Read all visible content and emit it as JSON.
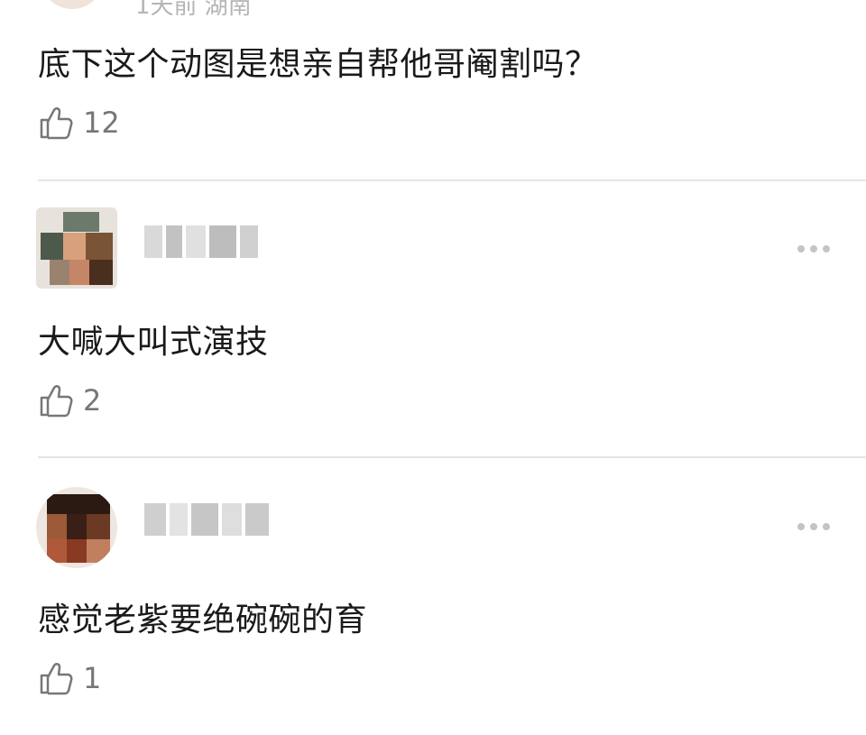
{
  "comments": [
    {
      "meta": "1天前 湖南",
      "text": "底下这个动图是想亲自帮他哥阉割吗？",
      "likes": "12"
    },
    {
      "text": "大喊大叫式演技",
      "likes": "2"
    },
    {
      "text": "感觉老紫要绝碗碗的育",
      "likes": "1"
    }
  ],
  "icons": {
    "like": "thumbs-up-icon",
    "more": "more-icon"
  },
  "colors": {
    "text": "#1a1a1a",
    "meta": "#b5b5b5",
    "icon": "#777777",
    "divider": "#e5e5e5"
  }
}
